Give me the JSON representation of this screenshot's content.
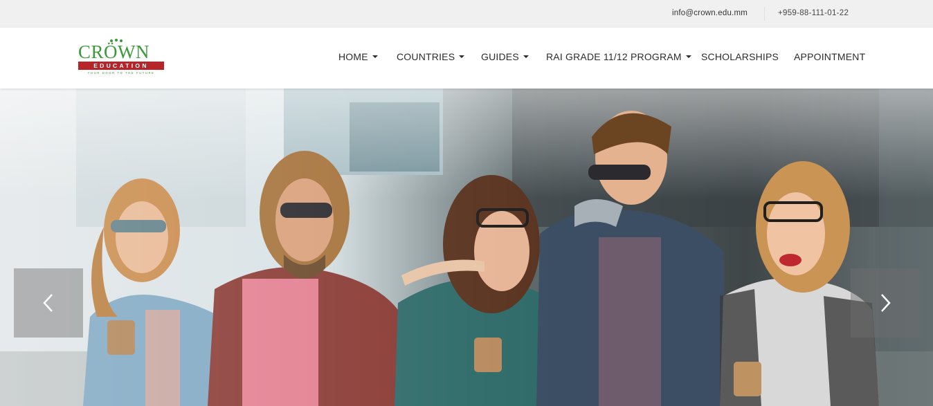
{
  "topbar": {
    "email": "info@crown.edu.mm",
    "phone": "+959-88-111-01-22"
  },
  "logo": {
    "name": "CRÖWN",
    "band": "EDUCATION",
    "tagline": "YOUR DOOR TO THE FUTURE"
  },
  "nav": {
    "items": [
      {
        "label": "HOME",
        "dropdown": true
      },
      {
        "label": "COUNTRIES",
        "dropdown": true
      },
      {
        "label": "GUIDES",
        "dropdown": true
      },
      {
        "label": "RAI GRADE 11/12 PROGRAM",
        "dropdown": true
      },
      {
        "label": "SCHOLARSHIPS",
        "dropdown": false
      },
      {
        "label": "APPOINTMENT",
        "dropdown": false
      }
    ]
  },
  "slider": {
    "prev_icon": "chevron-left-icon",
    "next_icon": "chevron-right-icon"
  },
  "colors": {
    "brand_green": "#3d9a3c",
    "brand_red": "#b5252a",
    "topbar_bg": "#f0f0f0"
  }
}
